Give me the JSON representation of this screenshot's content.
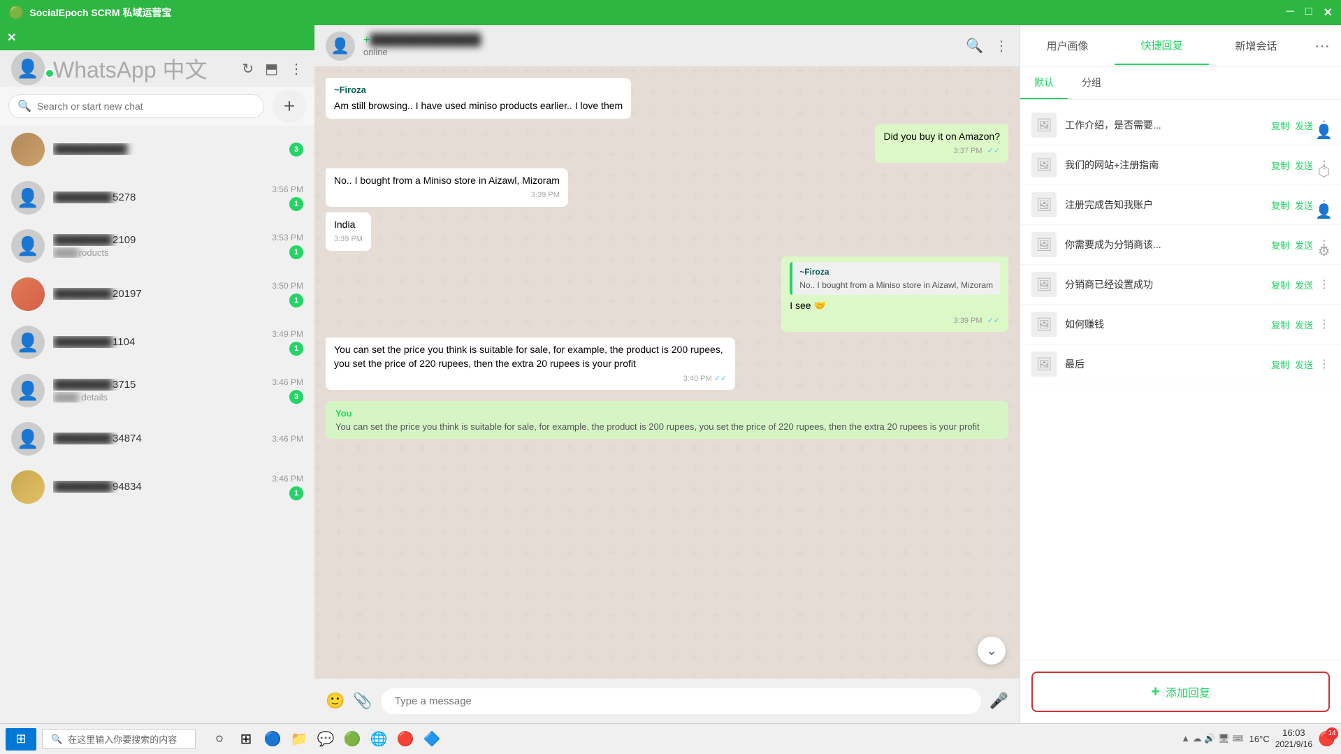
{
  "app": {
    "title": "SocialEpoch SCRM 私域运营宝",
    "window_controls": [
      "─",
      "□",
      "✕"
    ]
  },
  "sidebar": {
    "close_label": "✕",
    "title": "WhatsApp",
    "search_placeholder": "Search or start new chat",
    "new_chat_label": "+",
    "toolbar_icons": [
      "↻",
      "⬒",
      "⋮"
    ],
    "chats": [
      {
        "id": 1,
        "name_blurred": "████████",
        "name_suffix": "",
        "time": "",
        "preview": "",
        "badge": 3,
        "has_photo": true
      },
      {
        "id": 2,
        "name_blurred": "████████",
        "name_suffix": "5278",
        "time": "3:56 PM",
        "preview": "",
        "badge": 1,
        "has_photo": false
      },
      {
        "id": 3,
        "name_blurred": "████████",
        "name_suffix": "2109",
        "time": "3:53 PM",
        "preview": "roducts",
        "badge": 1,
        "has_photo": false
      },
      {
        "id": 4,
        "name_blurred": "████████",
        "name_suffix": "20197",
        "time": "3:50 PM",
        "preview": "",
        "badge": 1,
        "has_photo": true
      },
      {
        "id": 5,
        "name_blurred": "████████",
        "name_suffix": "1104",
        "time": "3:49 PM",
        "preview": "",
        "badge": 1,
        "has_photo": false
      },
      {
        "id": 6,
        "name_blurred": "████████",
        "name_suffix": "3715",
        "time": "3:46 PM",
        "preview": "details",
        "badge": 3,
        "has_photo": false
      },
      {
        "id": 7,
        "name_blurred": "████████",
        "name_suffix": "34874",
        "time": "3:46 PM",
        "preview": "",
        "badge": 0,
        "has_photo": false
      },
      {
        "id": 8,
        "name_blurred": "████████",
        "name_suffix": "94834",
        "time": "3:46 PM",
        "preview": "",
        "badge": 1,
        "has_photo": true
      }
    ]
  },
  "chat": {
    "contact_name_blurred": "████████████",
    "contact_status": "online",
    "messages": [
      {
        "id": 1,
        "type": "received",
        "sender": "~Firoza",
        "text": "Am still browsing.. I have used miniso products earlier.. I love them",
        "time": "",
        "ticks": ""
      },
      {
        "id": 2,
        "type": "sent",
        "text": "Did you buy it on Amazon?",
        "time": "3:37 PM",
        "ticks": "✓✓"
      },
      {
        "id": 3,
        "type": "received",
        "text": "No.. I bought from a Miniso store in Aizawl, Mizoram",
        "time": "3:39 PM",
        "ticks": ""
      },
      {
        "id": 4,
        "type": "received",
        "text": "India",
        "time": "3:39 PM",
        "ticks": ""
      },
      {
        "id": 5,
        "type": "sent",
        "sender_quote": "~Firoza",
        "quote_text": "No.. I bought from a Miniso store in Aizawl, Mizoram",
        "text": "I see 🤝",
        "time": "3:39 PM",
        "ticks": "✓✓"
      },
      {
        "id": 6,
        "type": "received",
        "text": "You can set the price you think is suitable for sale, for example, the product is 200 rupees, you set the price of 220 rupees, then the extra 20 rupees is your profit",
        "time": "3:40 PM",
        "ticks": "✓✓"
      }
    ],
    "quote_bubble": {
      "label": "You",
      "text": "You can set the price you think is suitable for sale, for example, the product is 200 rupees, you set the price of 220 rupees, then the extra 20 rupees is your profit"
    },
    "input_placeholder": "Type a message"
  },
  "right_panel": {
    "tabs": [
      "用户画像",
      "快捷回复",
      "新增会话"
    ],
    "more_icon": "⋯",
    "sub_tabs": [
      "默认",
      "分组"
    ],
    "quick_replies": [
      {
        "id": 1,
        "text": "工作介绍，是否需要..."
      },
      {
        "id": 2,
        "text": "我们的网站+注册指南"
      },
      {
        "id": 3,
        "text": "注册完成告知我账户"
      },
      {
        "id": 4,
        "text": "你需要成为分销商该..."
      },
      {
        "id": 5,
        "text": "分销商已经设置成功"
      },
      {
        "id": 6,
        "text": "如何赚钱"
      },
      {
        "id": 7,
        "text": "最后"
      }
    ],
    "action_copy": "复制",
    "action_send": "发送",
    "action_more": "⋮",
    "add_reply_label": "添加回复",
    "right_icons": [
      "👤",
      "⬡",
      "👤",
      "⚙"
    ]
  },
  "taskbar": {
    "start_icon": "⊞",
    "search_placeholder": "在这里输入你要搜索的内容",
    "search_icon": "🔍",
    "apps": [
      {
        "name": "circle",
        "icon": "○"
      },
      {
        "name": "grid",
        "icon": "⊞"
      },
      {
        "name": "blue-app",
        "icon": "🔵"
      },
      {
        "name": "folder",
        "icon": "📁"
      },
      {
        "name": "wechat",
        "icon": "💬"
      },
      {
        "name": "green-app",
        "icon": "🟢"
      },
      {
        "name": "edge",
        "icon": "🌐"
      },
      {
        "name": "chrome",
        "icon": "🔴"
      },
      {
        "name": "arrow-app",
        "icon": "🔷"
      }
    ],
    "system_tray": {
      "weather": "16°C",
      "time": "16:03",
      "date": "2021/9/16",
      "notification_count": "14"
    }
  }
}
